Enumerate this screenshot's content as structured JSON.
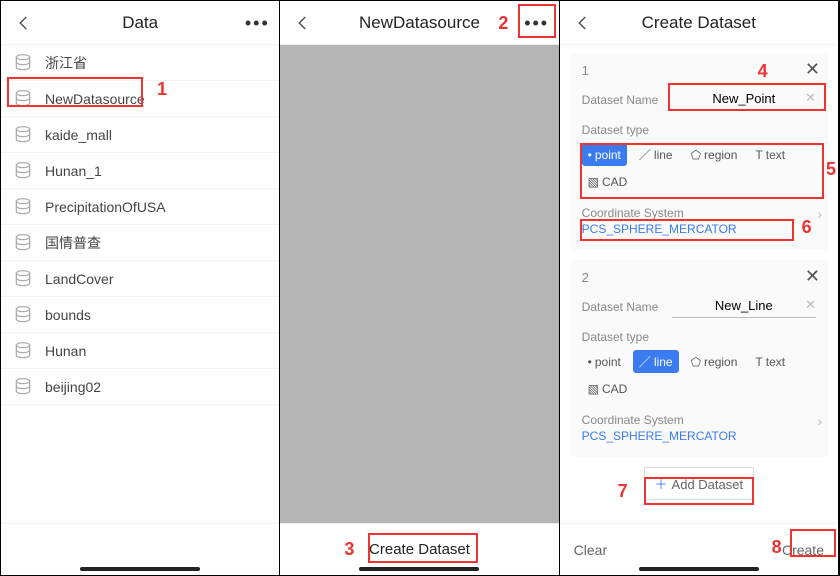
{
  "panel1": {
    "title": "Data",
    "datasources": [
      "浙江省",
      "NewDatasource",
      "kaide_mall",
      "Hunan_1",
      "PrecipitationOfUSA",
      "国情普查",
      "LandCover",
      "bounds",
      "Hunan",
      "beijing02"
    ]
  },
  "panel2": {
    "title": "NewDatasource",
    "create_button": "Create Dataset"
  },
  "panel3": {
    "title": "Create Dataset",
    "cards": [
      {
        "index": "1",
        "name_label": "Dataset Name",
        "name_value": "New_Point",
        "type_label": "Dataset type",
        "types": [
          {
            "icon": "•",
            "label": "point",
            "selected": true
          },
          {
            "icon": "／",
            "label": "line",
            "selected": false
          },
          {
            "icon": "⬠",
            "label": "region",
            "selected": false
          },
          {
            "icon": "T",
            "label": "text",
            "selected": false
          },
          {
            "icon": "▧",
            "label": "CAD",
            "selected": false
          }
        ],
        "coord_label": "Coordinate System",
        "coord_value": "PCS_SPHERE_MERCATOR"
      },
      {
        "index": "2",
        "name_label": "Dataset Name",
        "name_value": "New_Line",
        "type_label": "Dataset type",
        "types": [
          {
            "icon": "•",
            "label": "point",
            "selected": false
          },
          {
            "icon": "／",
            "label": "line",
            "selected": true
          },
          {
            "icon": "⬠",
            "label": "region",
            "selected": false
          },
          {
            "icon": "T",
            "label": "text",
            "selected": false
          },
          {
            "icon": "▧",
            "label": "CAD",
            "selected": false
          }
        ],
        "coord_label": "Coordinate System",
        "coord_value": "PCS_SPHERE_MERCATOR"
      }
    ],
    "add_button": "Add Dataset",
    "clear_button": "Clear",
    "create_button": "Create"
  },
  "annotations": {
    "n1": "1",
    "n2": "2",
    "n3": "3",
    "n4": "4",
    "n5": "5",
    "n6": "6",
    "n7": "7",
    "n8": "8"
  }
}
